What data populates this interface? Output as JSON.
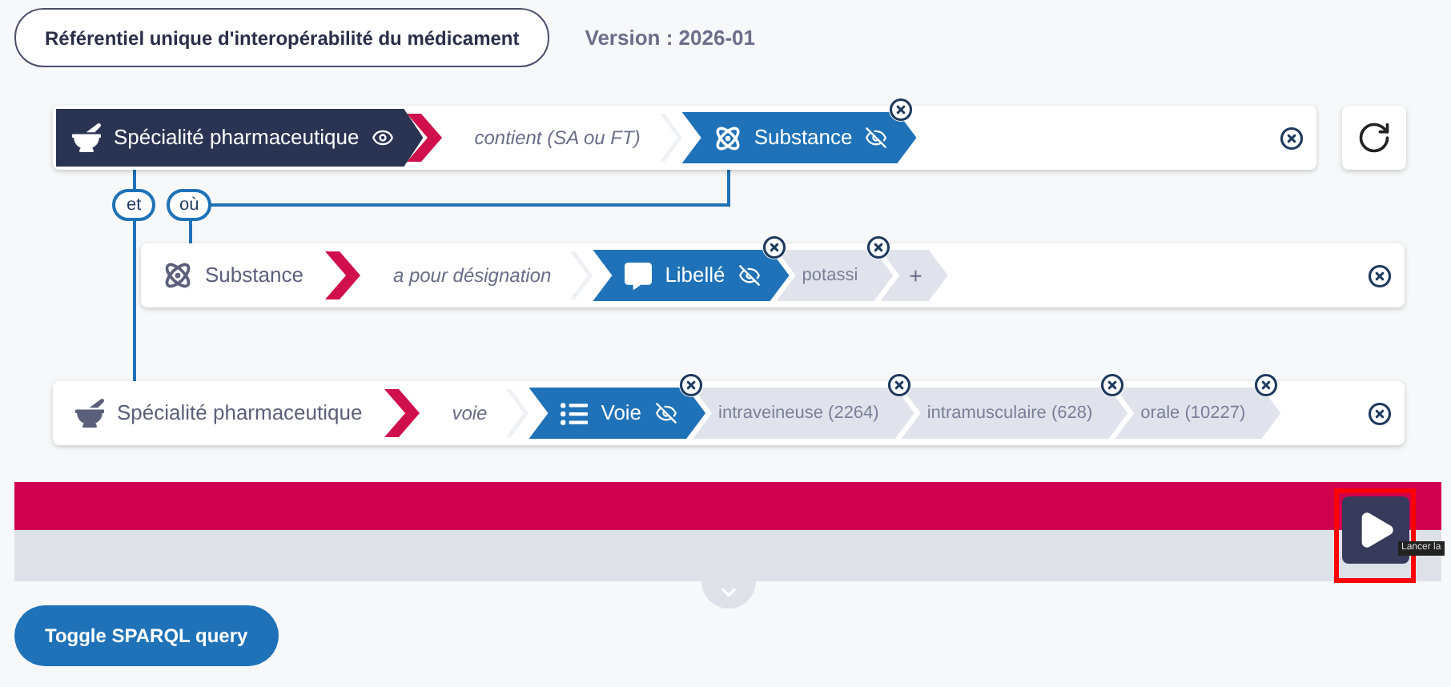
{
  "header": {
    "title": "Référentiel unique d'interopérabilité du médicament",
    "version": "Version : 2026-01"
  },
  "criteria": [
    {
      "subject": {
        "label": "Spécialité pharmaceutique",
        "kind": "product",
        "highlighted": true,
        "visible": true
      },
      "predicate": "contient (SA ou FT)",
      "object": {
        "label": "Substance",
        "kind": "substance",
        "visible": false
      }
    },
    {
      "subject": {
        "label": "Substance",
        "kind": "substance",
        "highlighted": false
      },
      "predicate": "a pour désignation",
      "object": {
        "label": "Libellé",
        "kind": "text",
        "visible": false
      },
      "values": [
        {
          "kind": "value",
          "label": "potassi"
        },
        {
          "kind": "add",
          "label": "+"
        }
      ]
    },
    {
      "subject": {
        "label": "Spécialité pharmaceutique",
        "kind": "product",
        "highlighted": false
      },
      "predicate": "voie",
      "object": {
        "label": "Voie",
        "kind": "list",
        "visible": false
      },
      "values": [
        {
          "kind": "value",
          "label": "intraveineuse (2264)"
        },
        {
          "kind": "value",
          "label": "intramusculaire (628)"
        },
        {
          "kind": "value",
          "label": "orale (10227)"
        }
      ]
    }
  ],
  "connectors": [
    {
      "label": "et"
    },
    {
      "label": "où"
    }
  ],
  "search": {
    "tooltip": "Lancer la",
    "highlighted": true
  },
  "toggle_button": "Toggle SPARQL query"
}
